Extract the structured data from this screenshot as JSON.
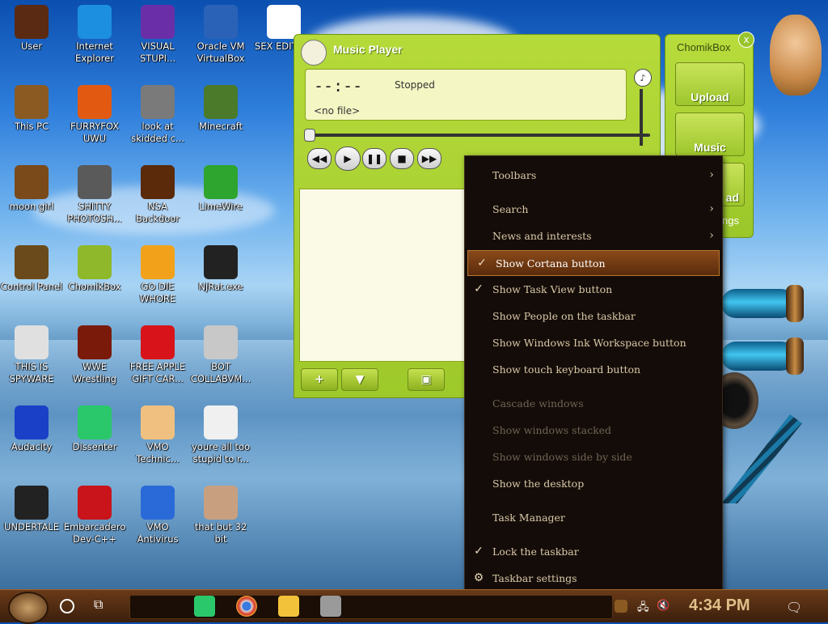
{
  "desktop_icons": [
    {
      "label": "User",
      "color": "#5b2a12"
    },
    {
      "label": "Internet Explorer",
      "color": "#1d8fe0"
    },
    {
      "label": "VISUAL STUPI...",
      "color": "#6a2fa8"
    },
    {
      "label": "Oracle VM VirtualBox",
      "color": "#2a62b8"
    },
    {
      "label": "SEX EDITO...",
      "color": "#ffffff"
    },
    {
      "label": "This PC",
      "color": "#8a5a22"
    },
    {
      "label": "FURRYFOX UWU",
      "color": "#e25a12"
    },
    {
      "label": "look at skidded c...",
      "color": "#7a7a7a"
    },
    {
      "label": "Minecraft",
      "color": "#4a7a2a"
    },
    {
      "label": "moon girl",
      "color": "#7a4a1a"
    },
    {
      "label": "SHITTY PHOTOSH...",
      "color": "#5a5a5a"
    },
    {
      "label": "NSA Backdoor",
      "color": "#5a2a0a"
    },
    {
      "label": "LimeWire",
      "color": "#2ea52e"
    },
    {
      "label": "Control Panel",
      "color": "#6a4a1a"
    },
    {
      "label": "ChomikBox",
      "color": "#8fb82a"
    },
    {
      "label": "GO DIE WHORE",
      "color": "#f2a21a"
    },
    {
      "label": "NjRat.exe",
      "color": "#222222"
    },
    {
      "label": "THIS IS SPYWARE",
      "color": "#e0e0e0"
    },
    {
      "label": "WWE Wrestling",
      "color": "#7a1a0a"
    },
    {
      "label": "FREE APPLE GIFT CAR...",
      "color": "#d8141a"
    },
    {
      "label": "BOT COLLABVM...",
      "color": "#c8c8c8"
    },
    {
      "label": "Audacity",
      "color": "#1a40c8"
    },
    {
      "label": "Dissenter",
      "color": "#2ac86a"
    },
    {
      "label": "VMO Technic...",
      "color": "#f0c080"
    },
    {
      "label": "youre all too stupid to r...",
      "color": "#f0f0f0"
    },
    {
      "label": "UNDERTALE",
      "color": "#222222"
    },
    {
      "label": "Embarcadero Dev-C++",
      "color": "#c8141a"
    },
    {
      "label": "VMO Antivirus",
      "color": "#2a6ad8"
    },
    {
      "label": "that but 32 bit",
      "color": "#c8a080"
    }
  ],
  "music_player": {
    "title": "Music Player",
    "time": "--:--",
    "status": "Stopped",
    "file": "<no file>",
    "controls": [
      "rewind",
      "play",
      "pause",
      "stop",
      "forward"
    ],
    "add_label": "+",
    "down_label": "▼"
  },
  "chomikbox": {
    "title": "ChomikBox",
    "close": "x",
    "tiles": [
      "Upload",
      "Music",
      "ad",
      "ngs"
    ]
  },
  "context_menu": [
    {
      "label": "Toolbars",
      "checked": false,
      "submenu": true,
      "disabled": false,
      "highlight": false
    },
    {
      "label": "Search",
      "checked": false,
      "submenu": true,
      "disabled": false,
      "highlight": false
    },
    {
      "label": "News and interests",
      "checked": false,
      "submenu": true,
      "disabled": false,
      "highlight": false
    },
    {
      "label": "Show Cortana button",
      "checked": true,
      "submenu": false,
      "disabled": false,
      "highlight": true
    },
    {
      "label": "Show Task View button",
      "checked": true,
      "submenu": false,
      "disabled": false,
      "highlight": false
    },
    {
      "label": "Show People on the taskbar",
      "checked": false,
      "submenu": false,
      "disabled": false,
      "highlight": false
    },
    {
      "label": "Show Windows Ink Workspace button",
      "checked": false,
      "submenu": false,
      "disabled": false,
      "highlight": false
    },
    {
      "label": "Show touch keyboard button",
      "checked": false,
      "submenu": false,
      "disabled": false,
      "highlight": false
    },
    {
      "label": "Cascade windows",
      "checked": false,
      "submenu": false,
      "disabled": true,
      "highlight": false
    },
    {
      "label": "Show windows stacked",
      "checked": false,
      "submenu": false,
      "disabled": true,
      "highlight": false
    },
    {
      "label": "Show windows side by side",
      "checked": false,
      "submenu": false,
      "disabled": true,
      "highlight": false
    },
    {
      "label": "Show the desktop",
      "checked": false,
      "submenu": false,
      "disabled": false,
      "highlight": false
    },
    {
      "label": "Task Manager",
      "checked": false,
      "submenu": false,
      "disabled": false,
      "highlight": false
    },
    {
      "label": "Lock the taskbar",
      "checked": true,
      "submenu": false,
      "disabled": false,
      "highlight": false
    },
    {
      "label": "Taskbar settings",
      "checked": false,
      "submenu": false,
      "disabled": false,
      "highlight": false,
      "icon": "gear-icon"
    }
  ],
  "taskbar": {
    "clock": "4:34 PM",
    "task_view_icon": "task-view-icon",
    "search_icon": "cortana-circle-icon",
    "pinned": [
      {
        "name": "dissenter-icon",
        "color": "#2ac86a"
      },
      {
        "name": "chrome-icon",
        "color": "#e0e0e0"
      },
      {
        "name": "file-explorer-icon",
        "color": "#f2c23a"
      },
      {
        "name": "chomikbox-icon",
        "color": "#9a9a9a"
      }
    ]
  }
}
